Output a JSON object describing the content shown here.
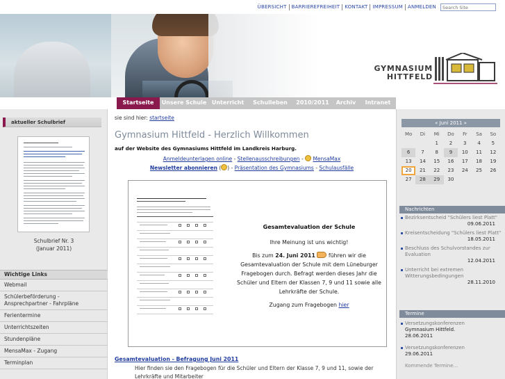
{
  "top": {
    "links": [
      "ÜBERSICHT",
      "BARRIEREFREIHEIT",
      "KONTAKT",
      "IMPRESSUM",
      "ANMELDEN"
    ],
    "search_placeholder": "Search Site"
  },
  "logo": {
    "line1": "GYMNASIUM",
    "line2": "HITTFELD"
  },
  "nav": [
    {
      "label": "Startseite",
      "active": true
    },
    {
      "label": "Unsere Schule"
    },
    {
      "label": "Unterricht"
    },
    {
      "label": "Schulleben"
    },
    {
      "label": "2010/2011"
    },
    {
      "label": "Archiv"
    },
    {
      "label": "Intranet"
    }
  ],
  "left": {
    "schulbrief_title": "aktueller Schulbrief",
    "schulbrief_caption1": "Schulbrief Nr. 3",
    "schulbrief_caption2": "(Januar 2011)",
    "links_title": "Wichtige Links",
    "links": [
      "Webmail",
      "Schülerbeförderung - Ansprechpartner - Fahrpläne",
      "Ferientermine",
      "Unterrichtszeiten",
      "Stundenpläne",
      "MensaMax - Zugang",
      "Terminplan"
    ]
  },
  "center": {
    "breadcrumb_label": "sie sind hier:",
    "breadcrumb_link": "startseite",
    "title": "Gymnasium Hittfeld - Herzlich Willkommen",
    "subtitle": "auf der Website des Gymnasiums Hittfeld im Landkreis Harburg.",
    "row1": {
      "a": "Anmeldeunterlagen online",
      "b": "Stellenausschreibungen",
      "c": "MensaMax"
    },
    "row2": {
      "a": "Newsletter abonnieren",
      "b": "Präsentation des Gymnasiums",
      "c": "Schulausfälle"
    },
    "eval_title": "Gesamtevaluation der Schule",
    "eval_p1": "Ihre Meinung ist uns wichtig!",
    "eval_p2a": "Bis zum",
    "eval_p2b": "24. Juni 2011",
    "eval_p2c": "führen wir die Gesamtevaluation der Schule mit dem Lüneburger Fragebogen durch. Befragt werden dieses Jahr die Schüler und Eltern der Klassen 7, 9 und 11 sowie alle Lehrkräfte der Schule.",
    "eval_p3": "Zugang zum Fragebogen",
    "eval_p3_link": "hier",
    "news_link": "Gesamtevaluation - Befragung Juni 2011",
    "news_text": "Hier finden sie den Fragebogen für die Schüler und Eltern der Klasse 7, 9 und 11, sowie der Lehrkräfte und Mitarbeiter"
  },
  "calendar": {
    "header": "« Juni 2011 »",
    "dow": [
      "Mo",
      "Di",
      "Mi",
      "Do",
      "Fr",
      "Sa",
      "So"
    ],
    "rows": [
      [
        "",
        "",
        "1",
        "2",
        "3",
        "4",
        "5"
      ],
      [
        "6",
        "7",
        "8",
        "9",
        "10",
        "11",
        "12"
      ],
      [
        "13",
        "14",
        "15",
        "16",
        "17",
        "18",
        "19"
      ],
      [
        "20",
        "21",
        "22",
        "23",
        "24",
        "25",
        "26"
      ],
      [
        "27",
        "28",
        "29",
        "30",
        "",
        "",
        ""
      ]
    ],
    "highlighted": [
      "6",
      "9",
      "28",
      "29"
    ],
    "today": "20"
  },
  "nachrichten": {
    "title": "Nachrichten",
    "items": [
      {
        "text": "Bezirksentscheid \"Schülers liest Platt\"",
        "date": "09.06.2011"
      },
      {
        "text": "Kreisentscheidung \"Schülers liest Platt\"",
        "date": "18.05.2011"
      },
      {
        "text": "Beschluss des Schulvorstandes zur Evaluation",
        "date": "12.04.2011"
      },
      {
        "text": "Unterricht bei extremen Witterungsbedingungen",
        "date": "28.11.2010"
      }
    ]
  },
  "termine": {
    "title": "Termine",
    "items": [
      {
        "text": "Versetzungskonferenzen",
        "sub1": "Gymnasium Hittfeld.",
        "sub2": "28.06.2011"
      },
      {
        "text": "Versetzungskonferenzen",
        "sub1": "29.06.2011",
        "sub2": ""
      }
    ],
    "more": "Kommende Termine..."
  }
}
